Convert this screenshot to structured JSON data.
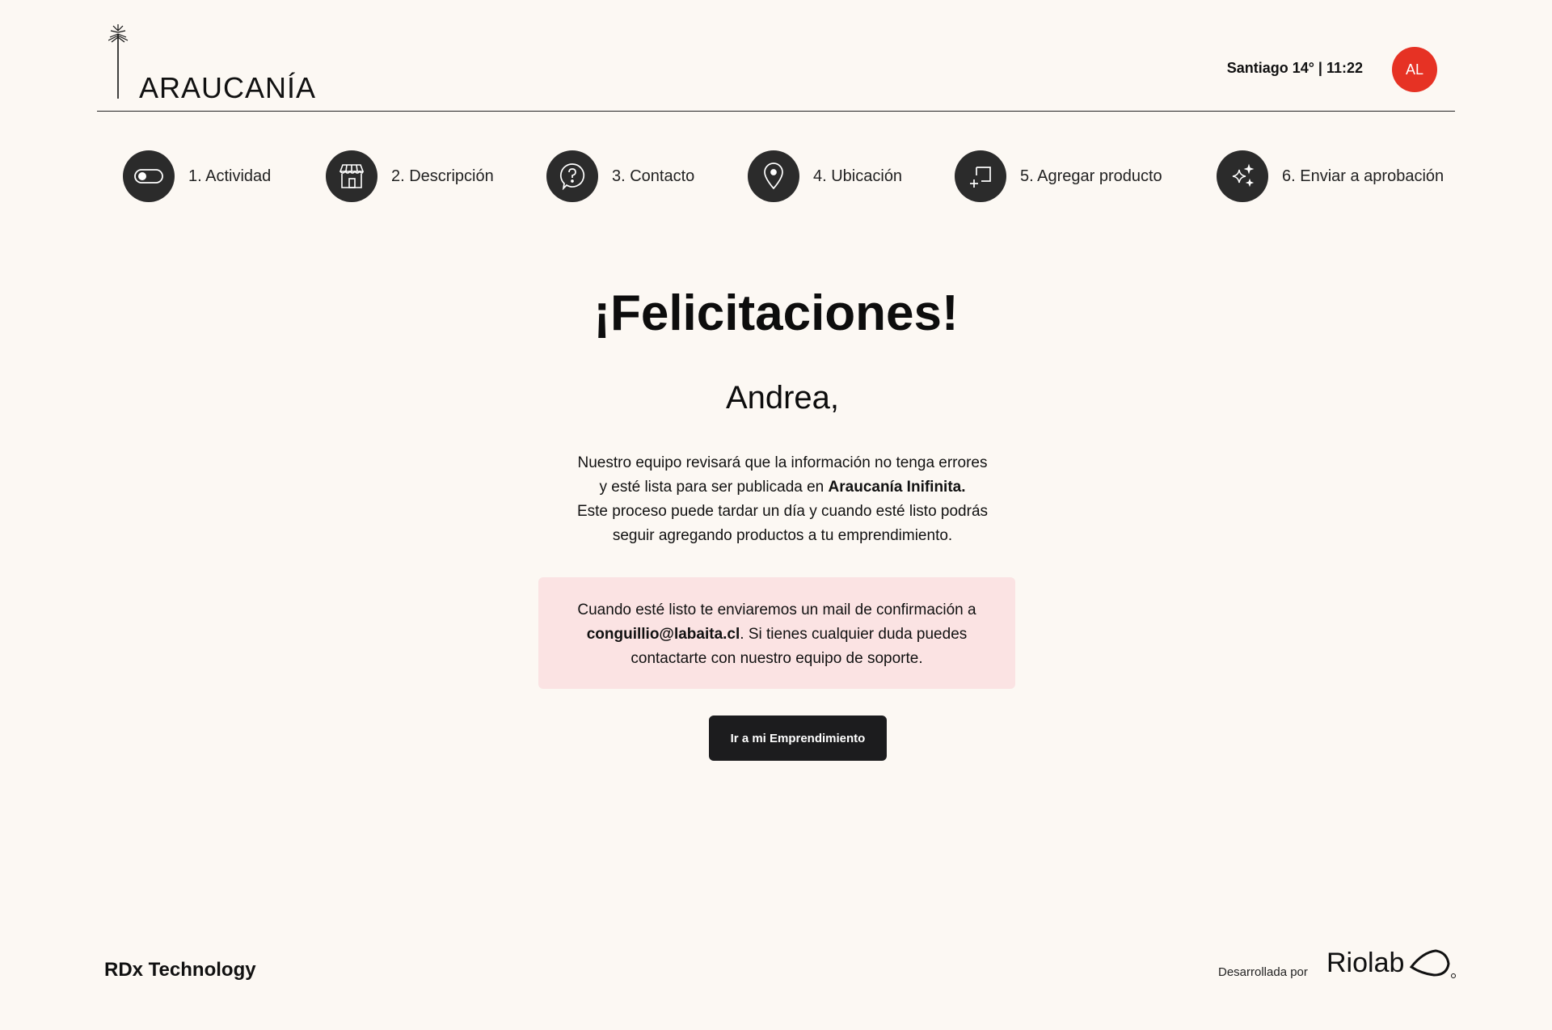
{
  "header": {
    "logo_text": "ARAUCANÍA",
    "weather": "Santiago 14° | 11:22",
    "avatar_initials": "AL"
  },
  "steps": [
    {
      "label": "1. Actividad",
      "icon": "toggle-icon"
    },
    {
      "label": "2. Descripción",
      "icon": "storefront-icon"
    },
    {
      "label": "3. Contacto",
      "icon": "question-bubble-icon"
    },
    {
      "label": "4. Ubicación",
      "icon": "map-pin-icon"
    },
    {
      "label": "5. Agregar producto",
      "icon": "add-product-icon"
    },
    {
      "label": "6. Enviar a aprobación",
      "icon": "sparkles-icon"
    }
  ],
  "main": {
    "title": "¡Felicitaciones!",
    "greeting": "Andrea,",
    "body_line1": "Nuestro equipo revisará que la información no tenga errores",
    "body_line2_pre": "y esté lista para ser publicada en ",
    "body_line2_bold": "Araucanía Inifinita.",
    "body_line3": "Este proceso puede tardar un día y cuando esté listo podrás",
    "body_line4": "seguir agregando productos a tu emprendimiento.",
    "notice_line1": "Cuando esté listo te enviaremos un mail de confirmación a",
    "notice_email": "conguillio@labaita.cl",
    "notice_line2_post": ". Si tienes cualquier duda puedes",
    "notice_line3": "contactarte con nuestro equipo de soporte.",
    "cta_label": "Ir a mi Emprendimiento"
  },
  "footer": {
    "company": "RDx Technology",
    "developed_by": "Desarrollada por",
    "brand": "Riolab"
  },
  "colors": {
    "background": "#fcf8f3",
    "avatar": "#e63224",
    "step_circle": "#2b2b2b",
    "notice_bg": "#fbe3e3",
    "button": "#1c1c1e"
  }
}
